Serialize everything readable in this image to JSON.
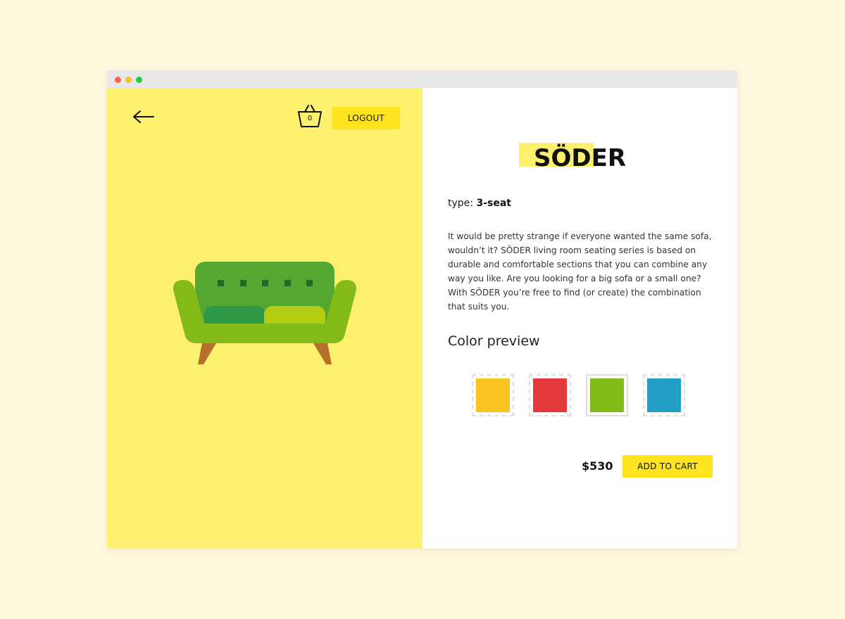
{
  "window": {
    "controls": [
      "close",
      "minimize",
      "maximize"
    ]
  },
  "header": {
    "back_icon": "arrow-left-icon",
    "basket_icon": "basket-icon",
    "basket_count": "0",
    "logout_label": "LOGOUT"
  },
  "product": {
    "image_icon": "sofa-icon",
    "title": "SÖDER",
    "type_label": "type:",
    "type_value": "3-seat",
    "description": "It would be pretty strange if everyone wanted the same sofa, wouldn’t it? SÖDER living room seating series is based on durable and comfortable sections that you can combine any way you like. Are you looking for a big sofa or a small one? With SÖDER you’re free to find (or create) the combination that suits you.",
    "color_heading": "Color preview",
    "colors": [
      "#f9c41f",
      "#e5383b",
      "#84bb18",
      "#219fc7"
    ],
    "selected_color_index": 2,
    "price": "$530",
    "add_to_cart_label": "ADD TO CART"
  },
  "colors": {
    "page_background": "#fff8de",
    "left_panel": "#fdf06e",
    "button": "#fde41e",
    "title_highlight": "#fdf06e"
  }
}
